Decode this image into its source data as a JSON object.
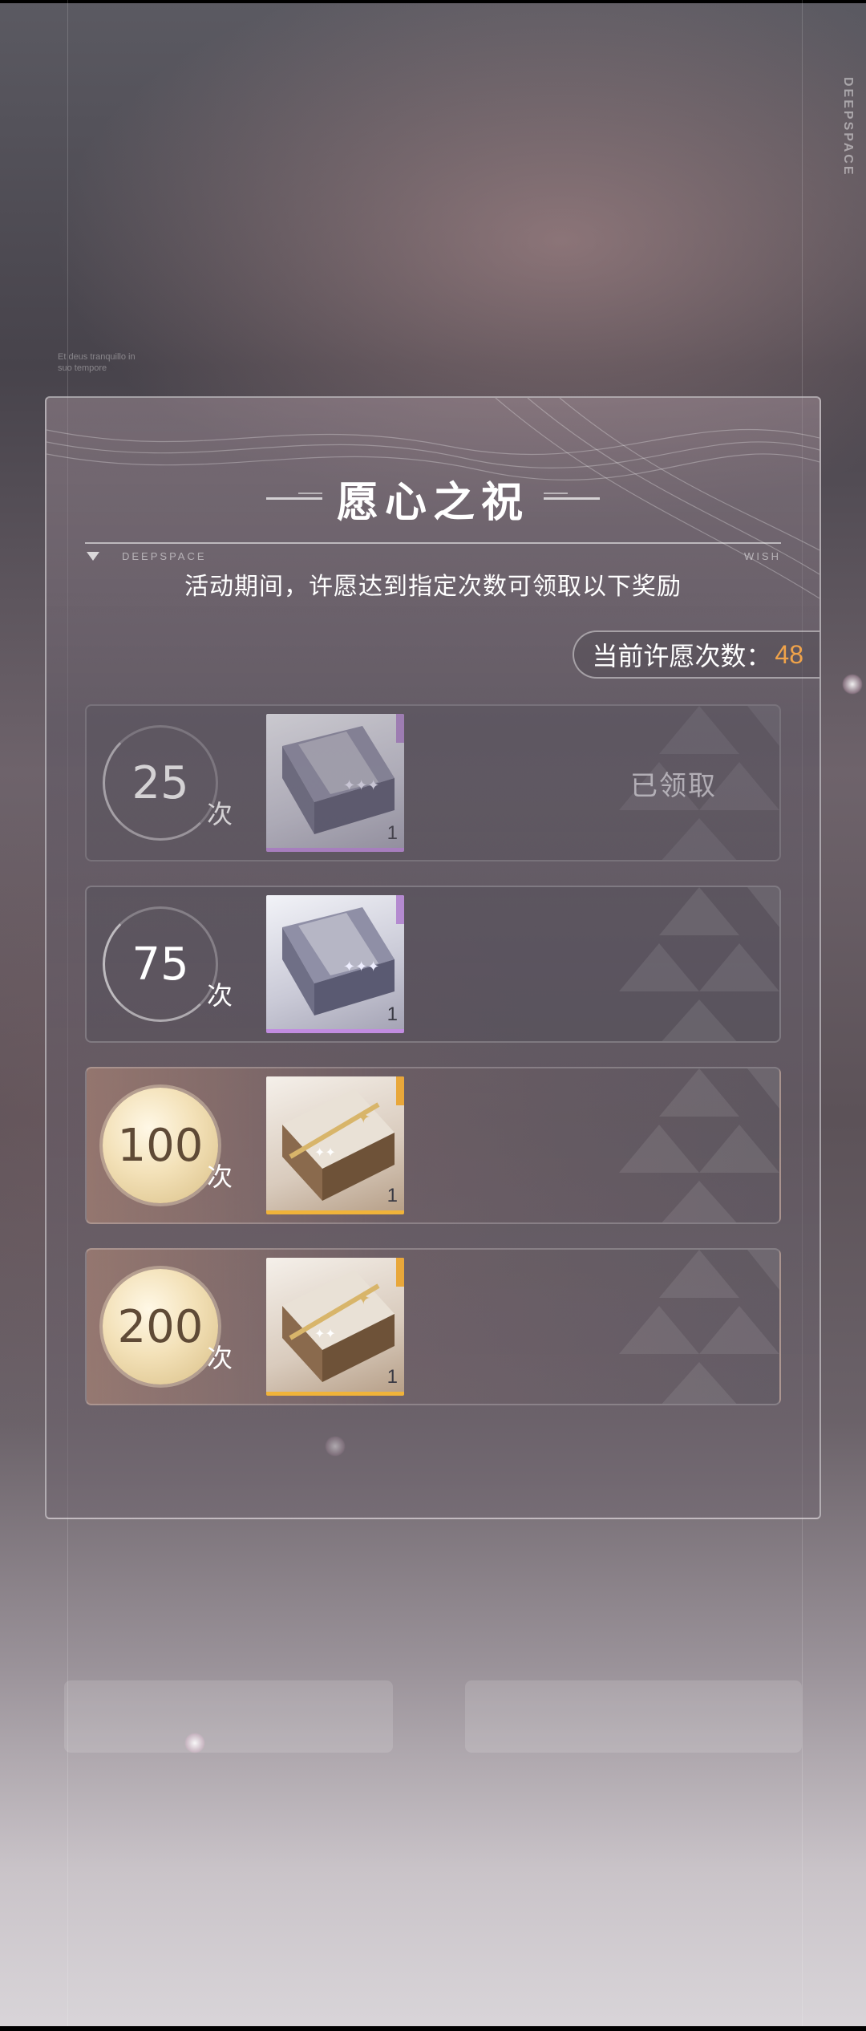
{
  "background": {
    "vertical_text": "DEEPSPACE",
    "scribble_lines": [
      "Et deus tranquillo in",
      "suo tempore"
    ]
  },
  "panel": {
    "title": "愿心之祝",
    "divider_left": "DEEPSPACE",
    "divider_right": "WISH",
    "subtitle": "活动期间，许愿达到指定次数可领取以下奖励",
    "counter_label": "当前许愿次数：",
    "counter_value": "48"
  },
  "milestones": [
    {
      "count": "25",
      "unit": "次",
      "reward_qty": "1",
      "status": "已领取"
    },
    {
      "count": "75",
      "unit": "次",
      "reward_qty": "1",
      "status": ""
    },
    {
      "count": "100",
      "unit": "次",
      "reward_qty": "1",
      "status": ""
    },
    {
      "count": "200",
      "unit": "次",
      "reward_qty": "1",
      "status": ""
    }
  ],
  "colors": {
    "accent_orange": "#f0a34a",
    "purple_rarity": "#c18ce0",
    "gold_rarity": "#f0b33a"
  }
}
